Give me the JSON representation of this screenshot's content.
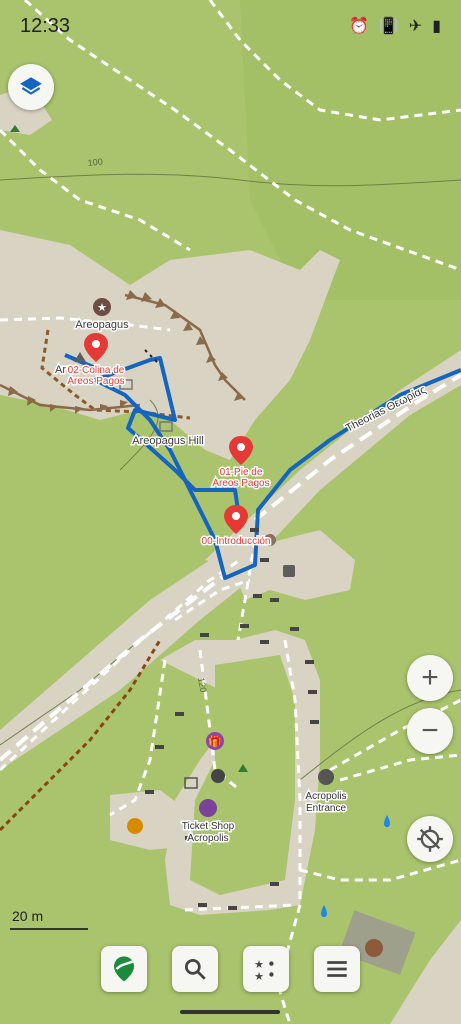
{
  "status_bar": {
    "time": "12:33",
    "icons": [
      "alarm-icon",
      "vibrate-icon",
      "airplane-icon",
      "battery-icon"
    ]
  },
  "map": {
    "labels": {
      "areopagus": "Areopagus",
      "areopagus_hill": "Areopagus Hill",
      "ar_fragment": "Ar",
      "theorias": "Theorias  Θεωρίας",
      "contour_100": "100",
      "contour_120": "120",
      "acropolis_entrance_line1": "Acropolis",
      "acropolis_entrance_line2": "Entrance",
      "ticket_shop_line1": "Ticket Shop",
      "ticket_shop_line2": "Acropolis"
    },
    "markers": [
      {
        "label_line1": "02-Colina de",
        "label_line2": "Areos Pagos"
      },
      {
        "label_line1": "01-Pie de",
        "label_line2": "Areos Pagos"
      },
      {
        "label_line1": "00-Introducción",
        "label_line2": ""
      }
    ],
    "colors": {
      "grass": "#a9c46c",
      "rock": "#d9d3c3",
      "route": "#1565c0",
      "marker": "#e53935",
      "marker_text": "#e53935",
      "path_white": "#ffffff",
      "cliff": "#8a6a48",
      "rail": "#8b4513"
    }
  },
  "controls": {
    "layers_icon": "layers-icon",
    "zoom_in_icon": "plus-icon",
    "zoom_out_icon": "minus-icon",
    "location_icon": "gps-off-icon"
  },
  "scale": {
    "label": "20 m"
  },
  "toolbar": {
    "buttons": [
      "logo-pin-icon",
      "search-icon",
      "favorites-icon",
      "menu-icon"
    ]
  }
}
